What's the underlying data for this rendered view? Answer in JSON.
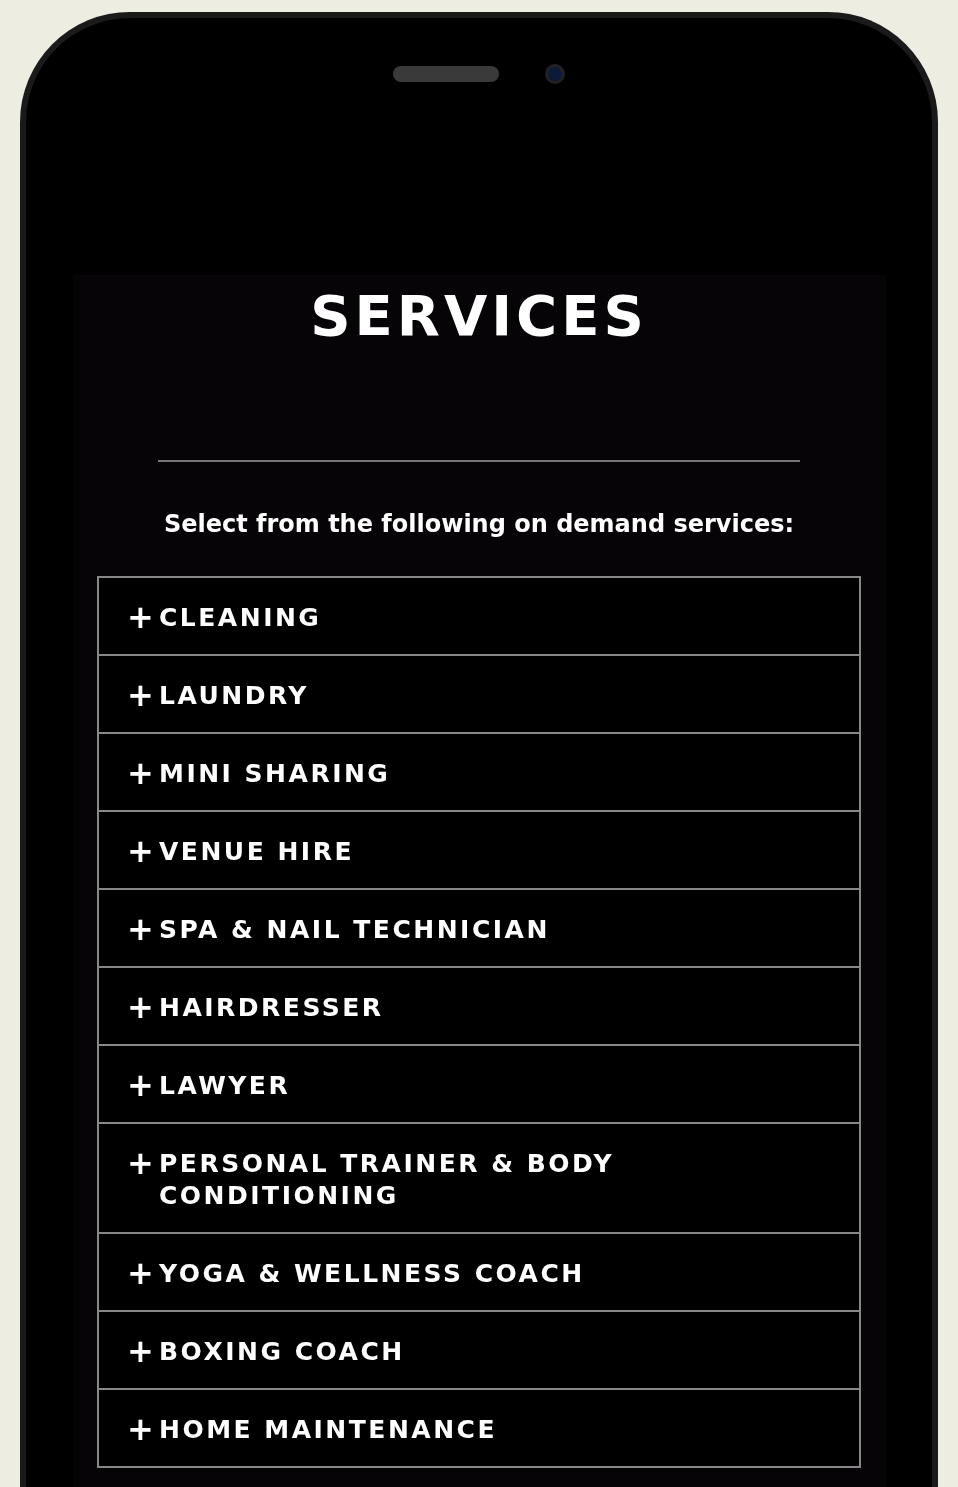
{
  "page": {
    "title": "SERVICES",
    "intro": "Select from the following on demand services:"
  },
  "services": [
    {
      "icon": "+",
      "label": "CLEANING"
    },
    {
      "icon": "+",
      "label": "LAUNDRY"
    },
    {
      "icon": "+",
      "label": "MINI SHARING"
    },
    {
      "icon": "+",
      "label": "VENUE HIRE"
    },
    {
      "icon": "+",
      "label": "SPA & NAIL TECHNICIAN"
    },
    {
      "icon": "+",
      "label": "HAIRDRESSER"
    },
    {
      "icon": "+",
      "label": "LAWYER"
    },
    {
      "icon": "+",
      "label": "PERSONAL TRAINER & BODY CONDITIONING"
    },
    {
      "icon": "+",
      "label": "YOGA & WELLNESS COACH"
    },
    {
      "icon": "+",
      "label": "BOXING COACH"
    },
    {
      "icon": "+",
      "label": "HOME MAINTENANCE"
    }
  ]
}
